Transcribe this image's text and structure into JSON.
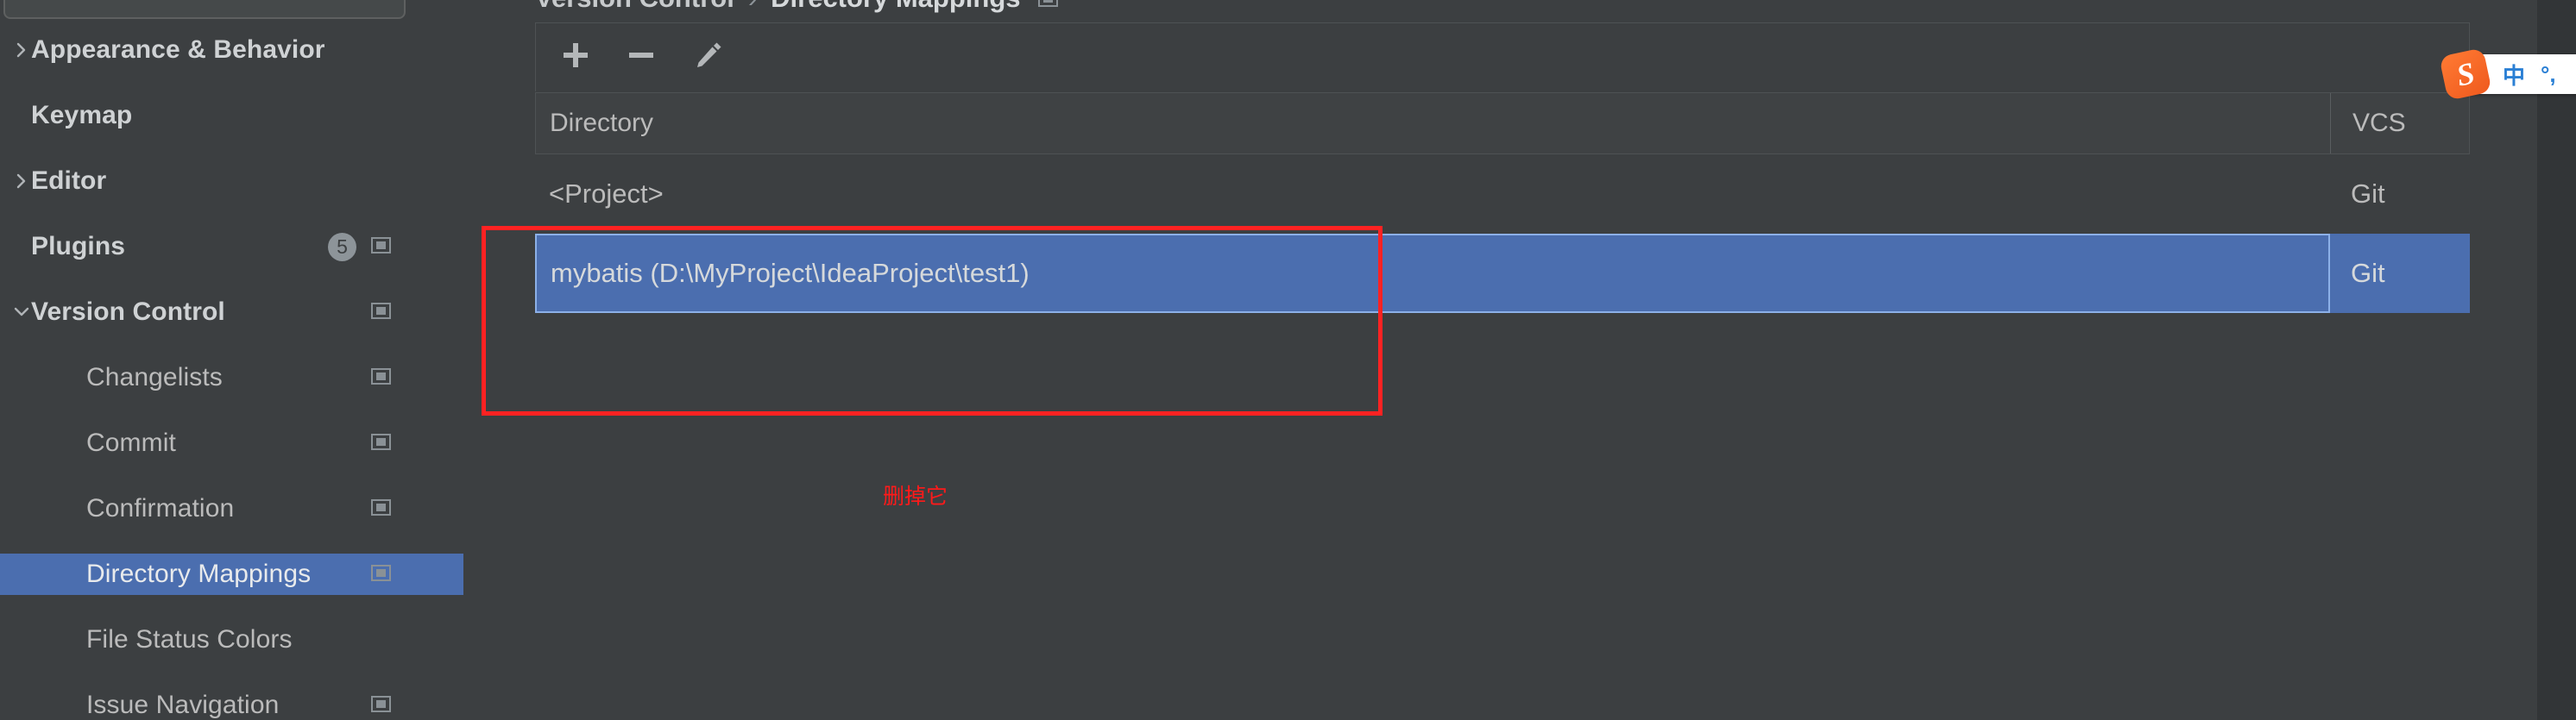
{
  "app": {
    "accent_blue": "#4b6eaf",
    "bg": "#3c3f41",
    "text": "#bbbbbb",
    "annotation_red": "#ff2222"
  },
  "sidebar": {
    "search": {
      "value": "",
      "placeholder": ""
    },
    "items": [
      {
        "label": "Appearance & Behavior",
        "level": 0,
        "chevron": "chevron-right-icon",
        "badge": null,
        "window_icon": false,
        "selected": false
      },
      {
        "label": "Keymap",
        "level": 0,
        "chevron": null,
        "badge": null,
        "window_icon": false,
        "selected": false
      },
      {
        "label": "Editor",
        "level": 0,
        "chevron": "chevron-right-icon",
        "badge": null,
        "window_icon": false,
        "selected": false
      },
      {
        "label": "Plugins",
        "level": 0,
        "chevron": null,
        "badge": "5",
        "window_icon": true,
        "selected": false
      },
      {
        "label": "Version Control",
        "level": 0,
        "chevron": "chevron-down-icon",
        "badge": null,
        "window_icon": true,
        "selected": false
      },
      {
        "label": "Changelists",
        "level": 2,
        "chevron": null,
        "badge": null,
        "window_icon": true,
        "selected": false
      },
      {
        "label": "Commit",
        "level": 2,
        "chevron": null,
        "badge": null,
        "window_icon": true,
        "selected": false
      },
      {
        "label": "Confirmation",
        "level": 2,
        "chevron": null,
        "badge": null,
        "window_icon": true,
        "selected": false
      },
      {
        "label": "Directory Mappings",
        "level": 2,
        "chevron": null,
        "badge": null,
        "window_icon": true,
        "selected": true
      },
      {
        "label": "File Status Colors",
        "level": 2,
        "chevron": null,
        "badge": null,
        "window_icon": false,
        "selected": false
      },
      {
        "label": "Issue Navigation",
        "level": 2,
        "chevron": null,
        "badge": null,
        "window_icon": true,
        "selected": false
      }
    ]
  },
  "breadcrumb": {
    "parent": "Version Control",
    "separator": "›",
    "current": "Directory Mappings",
    "window_icon": "restore-window-icon"
  },
  "toolbar": {
    "add_label": "+",
    "remove_label": "–",
    "edit_label": "edit",
    "add_icon": "plus-icon",
    "remove_icon": "minus-icon",
    "edit_icon": "pencil-icon"
  },
  "table": {
    "columns": [
      "Directory",
      "VCS"
    ],
    "rows": [
      {
        "directory": "<Project>",
        "vcs": "Git",
        "selected": false
      },
      {
        "directory": "mybatis (D:\\MyProject\\IdeaProject\\test1)",
        "vcs": "Git",
        "selected": true
      }
    ]
  },
  "annotation": {
    "text": "删掉它",
    "color": "#ff1a1a"
  },
  "ime": {
    "logo": "sogou-logo-icon",
    "logo_letter": "S",
    "items": [
      "中",
      "°,",
      "☺"
    ]
  }
}
